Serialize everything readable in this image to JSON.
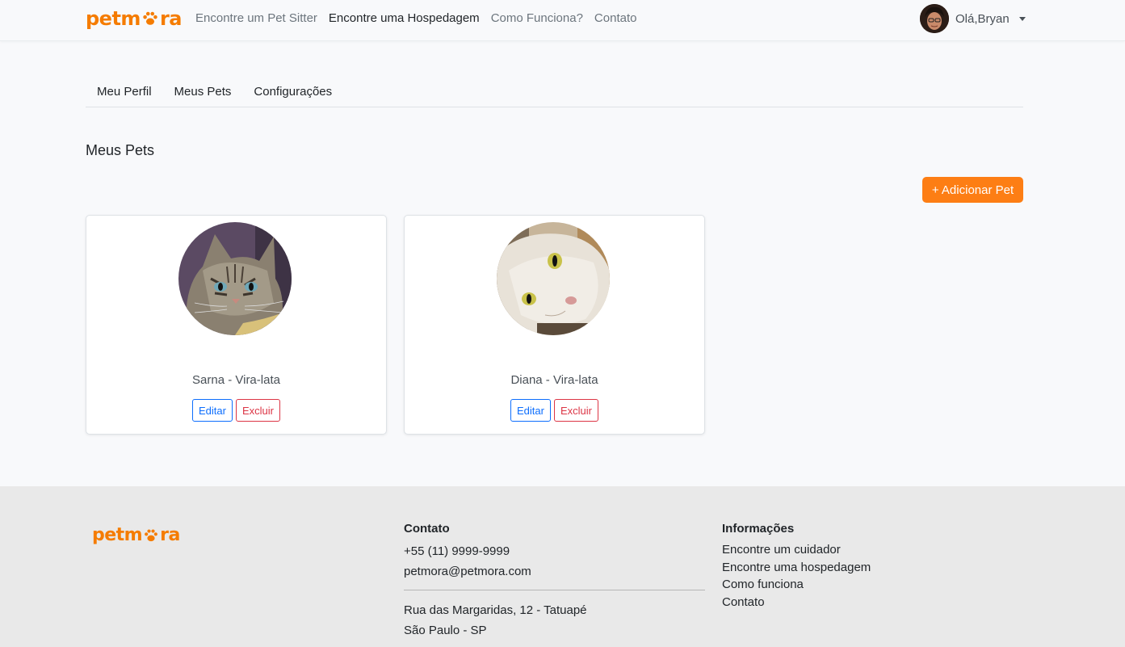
{
  "brand": {
    "name_pre": "petm",
    "name_post": "ra",
    "color": "#f57c00"
  },
  "nav": {
    "links": [
      {
        "label": "Encontre um Pet Sitter"
      },
      {
        "label": "Encontre uma Hospedagem"
      },
      {
        "label": "Como Funciona?"
      },
      {
        "label": "Contato"
      }
    ],
    "user_label": "Olá,Bryan"
  },
  "tabs": [
    {
      "label": "Meu Perfil"
    },
    {
      "label": "Meus Pets"
    },
    {
      "label": "Configurações"
    }
  ],
  "section_title": "Meus Pets",
  "add_button": "+ Adicionar Pet",
  "pets": [
    {
      "name": "Sarna  - Vira-lata",
      "edit": "Editar",
      "delete": "Excluir"
    },
    {
      "name": "Diana  - Vira-lata",
      "edit": "Editar",
      "delete": "Excluir"
    }
  ],
  "footer": {
    "contact": {
      "title": "Contato",
      "phone": "+55 (11) 9999-9999",
      "email": "petmora@petmora.com",
      "address1": "Rua das Margaridas, 12 - Tatuapé",
      "address2": "São Paulo - SP"
    },
    "info": {
      "title": "Informações",
      "links": [
        "Encontre um cuidador",
        "Encontre uma hospedagem",
        "Como funciona",
        "Contato"
      ]
    }
  },
  "colors": {
    "accent": "#fd7e14",
    "edit": "#0d6efd",
    "delete": "#dc3545"
  }
}
